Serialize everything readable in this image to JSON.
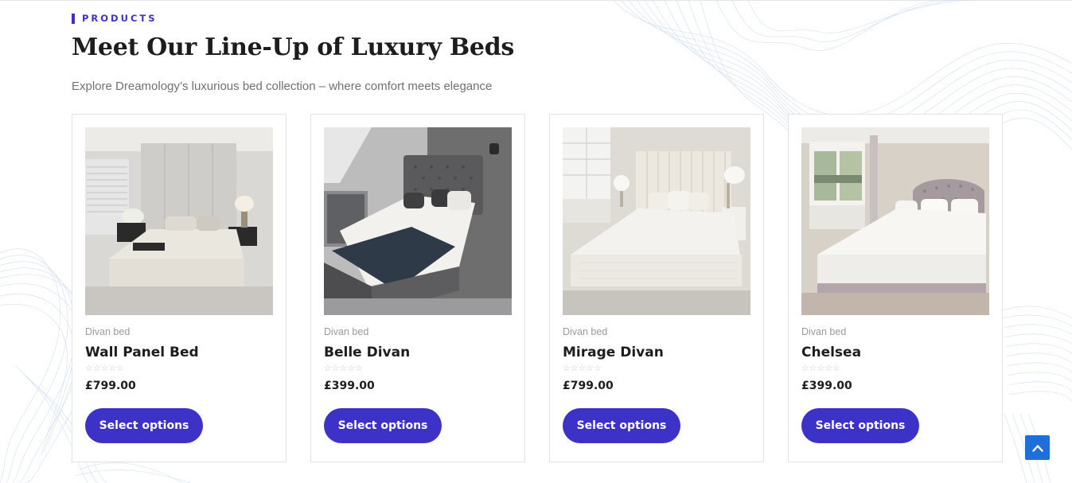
{
  "section": {
    "eyebrow": "PRODUCTS",
    "heading": "Meet Our Line-Up of Luxury Beds",
    "subheading": "Explore Dreamology’s luxurious bed collection – where comfort meets elegance"
  },
  "rating_stars": "☆☆☆☆☆",
  "products": [
    {
      "category": "Divan bed",
      "name": "Wall Panel Bed",
      "price": "£799.00",
      "button_label": "Select options"
    },
    {
      "category": "Divan bed",
      "name": "Belle Divan",
      "price": "£399.00",
      "button_label": "Select options"
    },
    {
      "category": "Divan bed",
      "name": "Mirage Divan",
      "price": "£799.00",
      "button_label": "Select options"
    },
    {
      "category": "Divan bed",
      "name": "Chelsea",
      "price": "£399.00",
      "button_label": "Select options"
    }
  ],
  "colors": {
    "accent": "#3d32c8",
    "scroll_top": "#1e6fd9"
  },
  "icons": {
    "scroll_top": "chevron-up-icon"
  }
}
